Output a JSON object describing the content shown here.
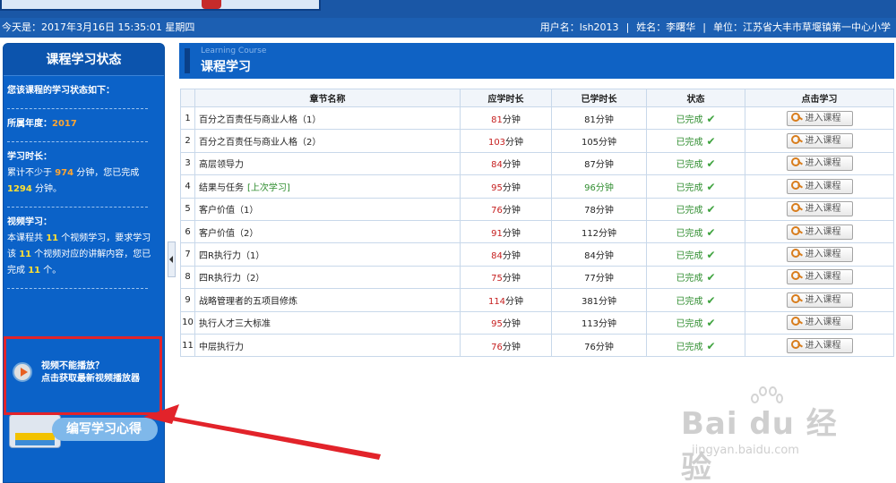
{
  "colors": {
    "header_blue": "#1c5fb2",
    "sidebar_blue": "#0b62c8",
    "highlight_orange": "#ffa631",
    "highlight_yellow": "#ffe033",
    "required_red": "#c62020",
    "status_green": "#2f8d2f",
    "annotation_red": "#e2232a"
  },
  "infobar": {
    "date": "今天是：2017年3月16日  15:35:01 星期四",
    "username": "用户名：lsh2013",
    "name": "姓名：李曙华",
    "unit": "单位：江苏省大丰市草堰镇第一中心小学",
    "separator": "|"
  },
  "sidebar": {
    "title": "课程学习状态",
    "intro": "您该课程的学习状态如下：",
    "year_label": "所属年度：",
    "year_value": "2017",
    "duration_label": "学习时长：",
    "duration_prefix": "累计不少于",
    "duration_required": "974",
    "duration_mid": "分钟，您已完成",
    "duration_done": "1294",
    "duration_suffix": "分钟。",
    "video_label": "视频学习：",
    "video_prefix": "本课程共",
    "video_total": "11",
    "video_mid": "个视频学习，要求学习该",
    "video_required": "11",
    "video_mid2": "个视频对应的讲解内容，您已完成",
    "video_done": "11",
    "video_suffix": "个。",
    "player_line1": "视频不能播放？",
    "player_line2": "点击获取最新视频播放器",
    "notes_button": "编写学习心得",
    "player_icon": "media-player-icon",
    "notes_icon": "books-icon"
  },
  "main": {
    "header_en": "Learning Course",
    "header_cn": "课程学习"
  },
  "table": {
    "columns": [
      "",
      "章节名称",
      "应学时长",
      "已学时长",
      "状态",
      "点击学习"
    ],
    "unit": "分钟",
    "status_done": "已完成",
    "enter_label": "进入课程",
    "last_tag": "[上次学习]",
    "rows": [
      {
        "no": "1",
        "title": "百分之百责任与商业人格（1）",
        "required": "81",
        "studied": "81分钟"
      },
      {
        "no": "2",
        "title": "百分之百责任与商业人格（2）",
        "required": "103",
        "studied": "105分钟"
      },
      {
        "no": "3",
        "title": "高层领导力",
        "required": "84",
        "studied": "87分钟"
      },
      {
        "no": "4",
        "title": "结果与任务",
        "required": "95",
        "studied": "96分钟",
        "last": true
      },
      {
        "no": "5",
        "title": "客户价值（1）",
        "required": "76",
        "studied": "78分钟"
      },
      {
        "no": "6",
        "title": "客户价值（2）",
        "required": "91",
        "studied": "112分钟"
      },
      {
        "no": "7",
        "title": "四R执行力（1）",
        "required": "84",
        "studied": "84分钟"
      },
      {
        "no": "8",
        "title": "四R执行力（2）",
        "required": "75",
        "studied": "77分钟"
      },
      {
        "no": "9",
        "title": "战略管理者的五项目修炼",
        "required": "114",
        "studied": "381分钟"
      },
      {
        "no": "10",
        "title": "执行人才三大标准",
        "required": "95",
        "studied": "113分钟"
      },
      {
        "no": "11",
        "title": "中层执行力",
        "required": "76",
        "studied": "76分钟"
      }
    ]
  },
  "watermark": {
    "main": "Bai du 经验",
    "sub": "jingyan.baidu.com"
  }
}
